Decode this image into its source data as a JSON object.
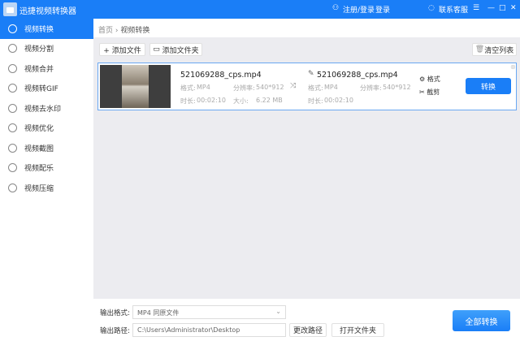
{
  "app": {
    "title": "迅捷视频转换器",
    "login": "注册/登录",
    "login2": "登录",
    "support": "联系客服"
  },
  "sidebar": {
    "items": [
      {
        "label": "视频转换"
      },
      {
        "label": "视频分割"
      },
      {
        "label": "视频合并"
      },
      {
        "label": "视频转GIF"
      },
      {
        "label": "视频去水印"
      },
      {
        "label": "视频优化"
      },
      {
        "label": "视频截图"
      },
      {
        "label": "视频配乐"
      },
      {
        "label": "视频压缩"
      }
    ]
  },
  "breadcrumb": {
    "home": "首页",
    "sep": "›",
    "current": "视频转换"
  },
  "toolbar": {
    "add_file": "+ 添加文件",
    "add_folder": "添加文件夹",
    "clear": "清空列表"
  },
  "file": {
    "name": "521069288_cps.mp4",
    "format_label": "格式:",
    "format": "MP4",
    "res_label": "分辨率:",
    "res": "540*912",
    "dur_label": "时长:",
    "dur": "00:02:10",
    "size_label": "大小:",
    "size": "6.22 MB",
    "out_name": "521069288_cps.mp4",
    "out_format": "MP4",
    "out_res": "540*912",
    "out_dur": "00:02:10",
    "format_btn": "格式",
    "cut_btn": "截剪",
    "convert": "转换"
  },
  "bottom": {
    "format_label": "输出格式:",
    "format_value": "MP4  同原文件",
    "path_label": "输出路径:",
    "path_value": "C:\\Users\\Administrator\\Desktop",
    "change_path": "更改路径",
    "open_folder": "打开文件夹",
    "convert_all": "全部转换"
  }
}
